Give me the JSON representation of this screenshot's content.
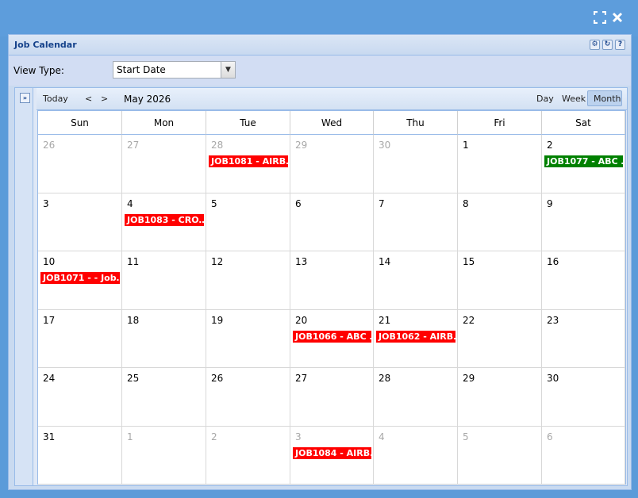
{
  "window": {
    "colors": {
      "accent": "#5d9ddc",
      "event_red": "#ff0000",
      "event_green": "#008000"
    }
  },
  "panel": {
    "title": "Job Calendar"
  },
  "view": {
    "label": "View Type:",
    "selected": "Start Date"
  },
  "toolbar": {
    "today": "Today",
    "prev": "<",
    "next": ">",
    "month_label": "May 2026",
    "views": [
      "Day",
      "Week",
      "Month"
    ],
    "active_view": "Month"
  },
  "calendar": {
    "weekdays": [
      "Sun",
      "Mon",
      "Tue",
      "Wed",
      "Thu",
      "Fri",
      "Sat"
    ],
    "weeks": [
      [
        {
          "day": "26",
          "other": true
        },
        {
          "day": "27",
          "other": true
        },
        {
          "day": "28",
          "other": true,
          "event": {
            "text": "JOB1081 - AIRB…",
            "color": "#ff0000"
          }
        },
        {
          "day": "29",
          "other": true
        },
        {
          "day": "30",
          "other": true
        },
        {
          "day": "1",
          "other": false
        },
        {
          "day": "2",
          "other": false,
          "event": {
            "text": "JOB1077 - ABC …",
            "color": "#008000"
          }
        }
      ],
      [
        {
          "day": "3",
          "other": false
        },
        {
          "day": "4",
          "other": false,
          "event": {
            "text": "JOB1083 - CRO…",
            "color": "#ff0000"
          }
        },
        {
          "day": "5",
          "other": false
        },
        {
          "day": "6",
          "other": false
        },
        {
          "day": "7",
          "other": false
        },
        {
          "day": "8",
          "other": false
        },
        {
          "day": "9",
          "other": false
        }
      ],
      [
        {
          "day": "10",
          "other": false,
          "event": {
            "text": "JOB1071 - - Job…",
            "color": "#ff0000"
          }
        },
        {
          "day": "11",
          "other": false
        },
        {
          "day": "12",
          "other": false
        },
        {
          "day": "13",
          "other": false
        },
        {
          "day": "14",
          "other": false
        },
        {
          "day": "15",
          "other": false
        },
        {
          "day": "16",
          "other": false
        }
      ],
      [
        {
          "day": "17",
          "other": false
        },
        {
          "day": "18",
          "other": false
        },
        {
          "day": "19",
          "other": false
        },
        {
          "day": "20",
          "other": false,
          "event": {
            "text": "JOB1066 - ABC …",
            "color": "#ff0000"
          }
        },
        {
          "day": "21",
          "other": false,
          "event": {
            "text": "JOB1062 - AIRB…",
            "color": "#ff0000"
          }
        },
        {
          "day": "22",
          "other": false
        },
        {
          "day": "23",
          "other": false
        }
      ],
      [
        {
          "day": "24",
          "other": false
        },
        {
          "day": "25",
          "other": false
        },
        {
          "day": "26",
          "other": false
        },
        {
          "day": "27",
          "other": false
        },
        {
          "day": "28",
          "other": false
        },
        {
          "day": "29",
          "other": false
        },
        {
          "day": "30",
          "other": false
        }
      ],
      [
        {
          "day": "31",
          "other": false
        },
        {
          "day": "1",
          "other": true
        },
        {
          "day": "2",
          "other": true
        },
        {
          "day": "3",
          "other": true,
          "event": {
            "text": "JOB1084 - AIRB…",
            "color": "#ff0000"
          }
        },
        {
          "day": "4",
          "other": true
        },
        {
          "day": "5",
          "other": true
        },
        {
          "day": "6",
          "other": true
        }
      ]
    ]
  }
}
